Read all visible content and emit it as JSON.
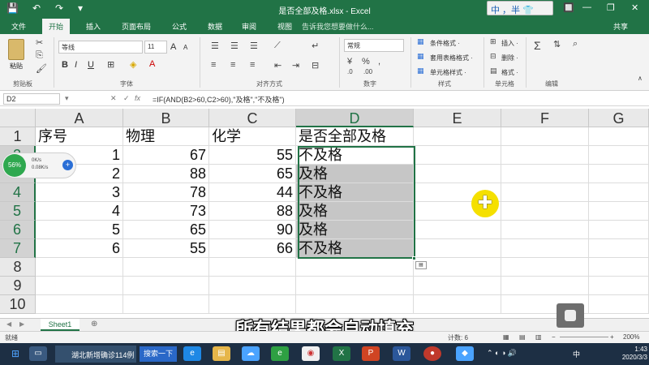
{
  "window": {
    "title": "是否全部及格.xlsx - Excel",
    "ime_label": "中 ，半 👕",
    "controls": [
      "🔲",
      "—",
      "❐",
      "✕"
    ]
  },
  "quick_access": {
    "save": "💾",
    "undo": "↶",
    "redo": "↷",
    "more": "▾"
  },
  "ribbon": {
    "tabs": [
      "文件",
      "开始",
      "插入",
      "页面布局",
      "公式",
      "数据",
      "审阅",
      "视图"
    ],
    "active_tab": "开始",
    "tell_me": "告诉我您想要做什么...",
    "share": "共享",
    "font_name": "等线",
    "font_size": "11",
    "number_format": "常规",
    "groups": [
      "剪贴板",
      "字体",
      "对齐方式",
      "数字",
      "样式",
      "单元格",
      "编辑"
    ],
    "paste_label": "粘贴",
    "styles_buttons": [
      "条件格式 ·",
      "套用表格格式 ·",
      "单元格样式 ·"
    ],
    "cells_buttons": [
      "插入 ·",
      "删除 ·",
      "格式 ·"
    ],
    "font_buttons": {
      "bold": "B",
      "italic": "I",
      "underline": "U",
      "grow": "A",
      "shrink": "A"
    }
  },
  "formula_bar": {
    "cell_ref": "D2",
    "formula": "=IF(AND(B2>60,C2>60),\"及格\",\"不及格\")",
    "cancel": "✕",
    "enter": "✓",
    "fx": "fx"
  },
  "sheet": {
    "columns": [
      "A",
      "B",
      "C",
      "D",
      "E",
      "F",
      "G"
    ],
    "rows": [
      "1",
      "2",
      "3",
      "4",
      "5",
      "6",
      "7",
      "8",
      "9",
      "10"
    ],
    "header": [
      "序号",
      "物理",
      "化学",
      "是否全部及格"
    ],
    "data": [
      [
        "1",
        "67",
        "55",
        "不及格"
      ],
      [
        "2",
        "88",
        "65",
        "及格"
      ],
      [
        "3",
        "78",
        "44",
        "不及格"
      ],
      [
        "4",
        "73",
        "88",
        "及格"
      ],
      [
        "5",
        "65",
        "90",
        "及格"
      ],
      [
        "6",
        "55",
        "66",
        "不及格"
      ]
    ],
    "tab": "Sheet1",
    "add_sheet": "⊕"
  },
  "net_widget": {
    "percent": "56%",
    "up": "0K/s",
    "down": "0.08K/s"
  },
  "subtitle": "所有结果都会自动填充",
  "status": {
    "ready": "就绪",
    "count": "计数: 6",
    "zoom": "200%"
  },
  "taskbar": {
    "task_label": "湖北新增确诊114例",
    "search_label": "搜索一下",
    "time": "1:43",
    "date": "2020/3/3"
  },
  "colors": {
    "accent": "#217346",
    "selection": "#c6c6c6",
    "taskbar": "#1d2f44"
  }
}
